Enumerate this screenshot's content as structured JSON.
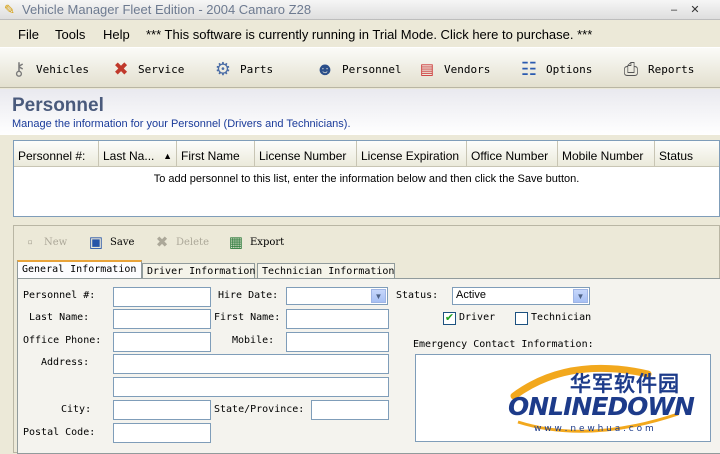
{
  "window": {
    "title": "Vehicle Manager Fleet Edition - 2004 Camaro Z28",
    "minimize": "–",
    "close": "✕"
  },
  "menu": {
    "file": "File",
    "tools": "Tools",
    "help": "Help",
    "trial_notice": "*** This software is currently running in Trial Mode.  Click here to purchase. ***"
  },
  "toolbar": {
    "vehicles": "Vehicles",
    "service": "Service",
    "parts": "Parts",
    "personnel": "Personnel",
    "vendors": "Vendors",
    "options": "Options",
    "reports": "Reports"
  },
  "header": {
    "title": "Personnel",
    "subtitle": "Manage the information for your Personnel (Drivers and Technicians)."
  },
  "grid": {
    "columns": [
      "Personnel #:",
      "Last Na...",
      "First Name",
      "License Number",
      "License Expiration",
      "Office Number",
      "Mobile Number",
      "Status"
    ],
    "empty_message": "To add personnel to this list, enter the information below and then click the Save button."
  },
  "actions": {
    "new": "New",
    "save": "Save",
    "delete": "Delete",
    "export": "Export"
  },
  "tabs": {
    "general": "General Information",
    "driver": "Driver Information",
    "technician": "Technician Information"
  },
  "form": {
    "personnel_no": "Personnel #:",
    "last_name": "Last Name:",
    "office_phone": "Office Phone:",
    "address": "Address:",
    "city": "City:",
    "postal_code": "Postal Code:",
    "hire_date": "Hire Date:",
    "first_name": "First Name:",
    "mobile": "Mobile:",
    "state": "State/Province:",
    "status": "Status:",
    "status_value": "Active",
    "driver": "Driver",
    "driver_checked": true,
    "technician": "Technician",
    "technician_checked": false,
    "emergency": "Emergency Contact Information:"
  },
  "watermark": {
    "cn": "华军软件园",
    "brand": "ONLINEDOWN",
    "url": "w w w . n e w h u a . c o m"
  }
}
